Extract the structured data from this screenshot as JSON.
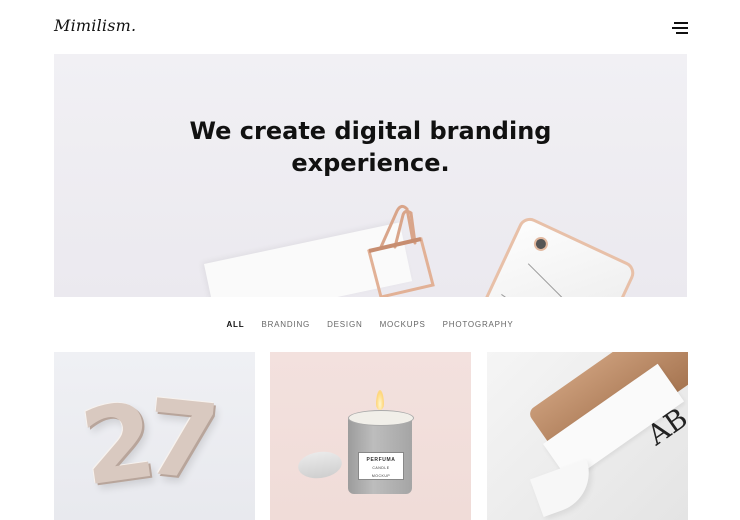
{
  "header": {
    "logo": "Mimilism",
    "logo_dot": ".",
    "menu_icon": "hamburger-menu-icon"
  },
  "hero": {
    "title_line1": "We create digital branding",
    "title_line2": "experience."
  },
  "filters": {
    "tabs": [
      {
        "label": "ALL",
        "active": true
      },
      {
        "label": "BRANDING",
        "active": false
      },
      {
        "label": "DESIGN",
        "active": false
      },
      {
        "label": "MOCKUPS",
        "active": false
      },
      {
        "label": "PHOTOGRAPHY",
        "active": false
      }
    ]
  },
  "portfolio": {
    "items": [
      {
        "balloon_left": "2",
        "balloon_right": "7"
      },
      {
        "label_brand": "PERFUMA",
        "label_sub1": "CANDLE",
        "label_sub2": "MOCKUP"
      },
      {
        "letters": "AB"
      }
    ]
  },
  "colors": {
    "accent": "#111111",
    "hero_bg": "#eeedf2",
    "card_pink": "#f2dfdb"
  }
}
